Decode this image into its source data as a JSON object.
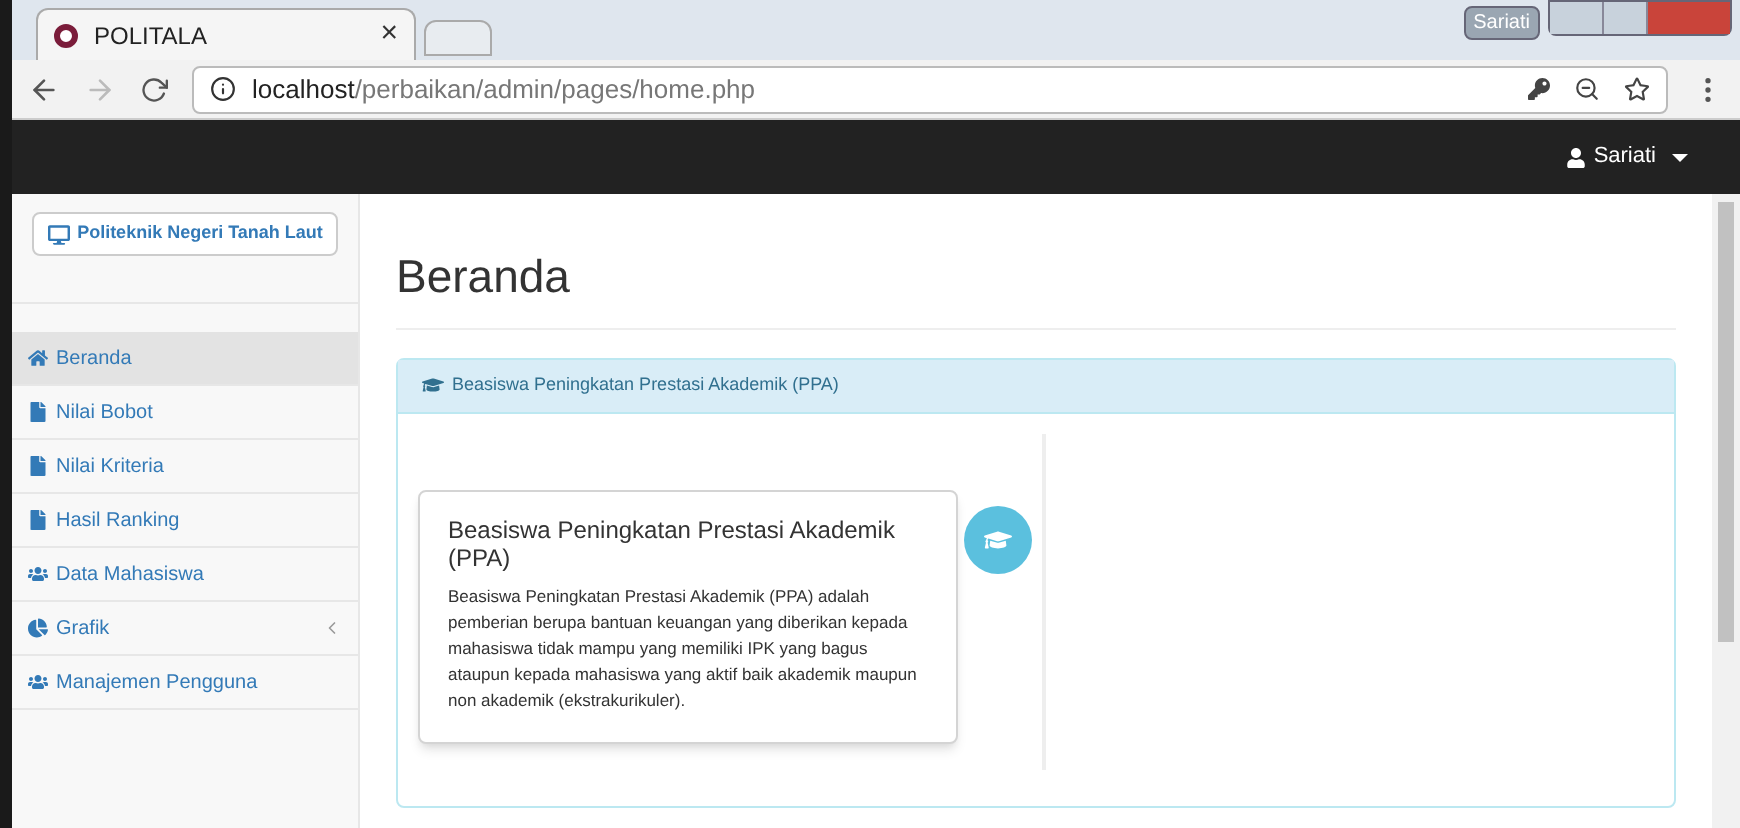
{
  "browser": {
    "tab_title": "POLITALA",
    "close": "×",
    "profile": "Sariati",
    "url_host": "localhost",
    "url_path": "/perbaikan/admin/pages/home.php"
  },
  "navbar": {
    "user": "Sariati"
  },
  "sidebar": {
    "brand_button": "Politeknik Negeri Tanah Laut",
    "items": [
      {
        "label": "Beranda",
        "kind": "home",
        "selected": true,
        "has_submenu": false
      },
      {
        "label": "Nilai Bobot",
        "kind": "file",
        "selected": false,
        "has_submenu": false
      },
      {
        "label": "Nilai Kriteria",
        "kind": "file",
        "selected": false,
        "has_submenu": false
      },
      {
        "label": "Hasil Ranking",
        "kind": "file",
        "selected": false,
        "has_submenu": false
      },
      {
        "label": "Data Mahasiswa",
        "kind": "users",
        "selected": false,
        "has_submenu": false
      },
      {
        "label": "Grafik",
        "kind": "pie",
        "selected": false,
        "has_submenu": true
      },
      {
        "label": "Manajemen Pengguna",
        "kind": "users",
        "selected": false,
        "has_submenu": false
      }
    ]
  },
  "page": {
    "title": "Beranda",
    "panel_heading": "Beasiswa Peningkatan Prestasi Akademik (PPA)",
    "timeline": [
      {
        "title": "Beasiswa Peningkatan Prestasi Akademik (PPA)",
        "body": "Beasiswa Peningkatan Prestasi Akademik (PPA) adalah pemberian berupa bantuan keuangan yang diberikan kepada mahasiswa tidak mampu yang memiliki IPK yang bagus ataupun kepada mahasiswa yang aktif baik akademik maupun non akademik (ekstrakurikuler)."
      }
    ]
  }
}
